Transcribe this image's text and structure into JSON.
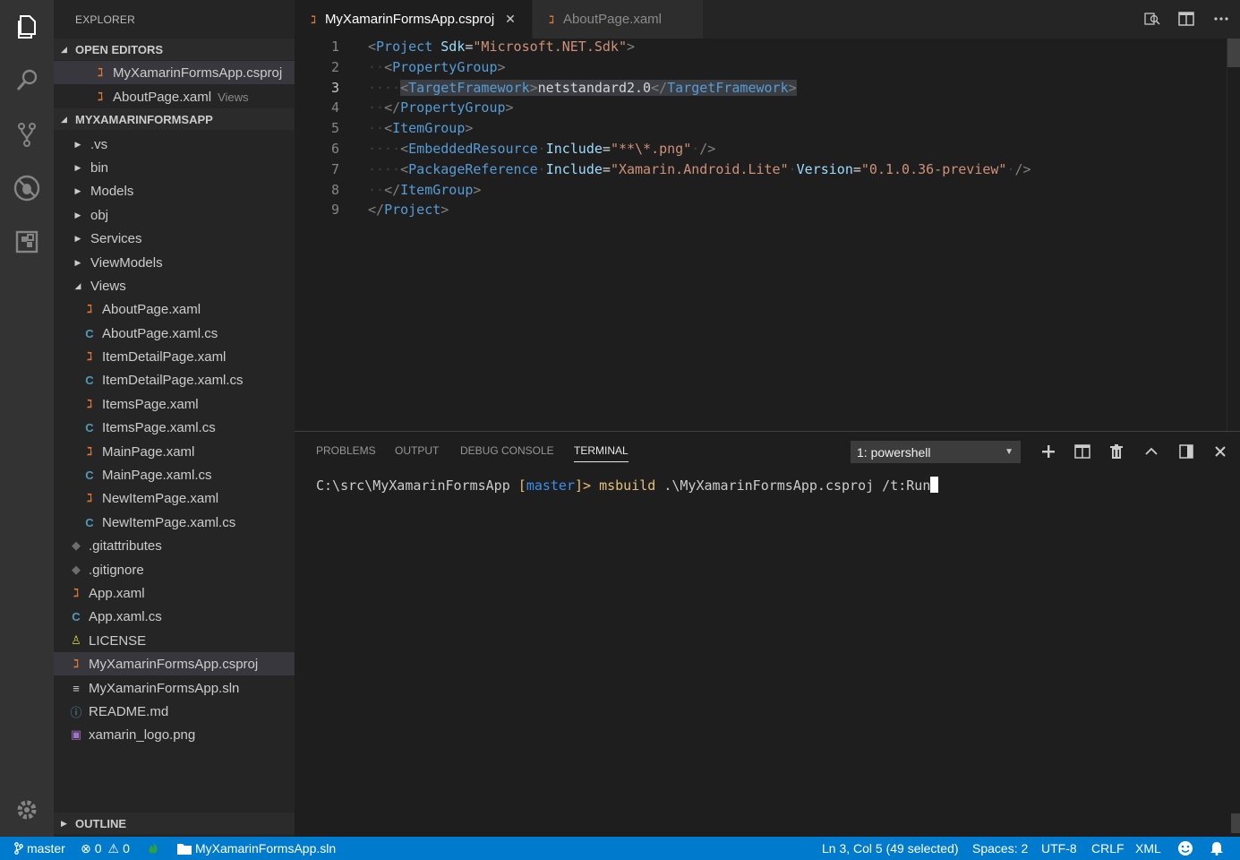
{
  "activity_bar": {
    "items": [
      {
        "icon": "explorer-icon"
      },
      {
        "icon": "search-icon"
      },
      {
        "icon": "source-control-icon"
      },
      {
        "icon": "debug-icon"
      },
      {
        "icon": "extensions-icon"
      }
    ],
    "bottom": {
      "icon": "settings-gear-icon"
    }
  },
  "sidebar": {
    "title": "EXPLORER",
    "open_editors": {
      "label": "OPEN EDITORS",
      "items": [
        {
          "name": "MyXamarinFormsApp.csproj",
          "desc": "",
          "icon": "rss-icon"
        },
        {
          "name": "AboutPage.xaml",
          "desc": "Views",
          "icon": "rss-icon"
        }
      ]
    },
    "project": {
      "label": "MYXAMARINFORMSAPP",
      "items": [
        {
          "name": ".vs",
          "type": "folder"
        },
        {
          "name": "bin",
          "type": "folder"
        },
        {
          "name": "Models",
          "type": "folder"
        },
        {
          "name": "obj",
          "type": "folder"
        },
        {
          "name": "Services",
          "type": "folder"
        },
        {
          "name": "ViewModels",
          "type": "folder"
        },
        {
          "name": "Views",
          "type": "folder-open"
        },
        {
          "name": "AboutPage.xaml",
          "type": "xaml"
        },
        {
          "name": "AboutPage.xaml.cs",
          "type": "cs"
        },
        {
          "name": "ItemDetailPage.xaml",
          "type": "xaml"
        },
        {
          "name": "ItemDetailPage.xaml.cs",
          "type": "cs"
        },
        {
          "name": "ItemsPage.xaml",
          "type": "xaml"
        },
        {
          "name": "ItemsPage.xaml.cs",
          "type": "cs"
        },
        {
          "name": "MainPage.xaml",
          "type": "xaml"
        },
        {
          "name": "MainPage.xaml.cs",
          "type": "cs"
        },
        {
          "name": "NewItemPage.xaml",
          "type": "xaml"
        },
        {
          "name": "NewItemPage.xaml.cs",
          "type": "cs"
        },
        {
          "name": ".gitattributes",
          "type": "git"
        },
        {
          "name": ".gitignore",
          "type": "git"
        },
        {
          "name": "App.xaml",
          "type": "xaml"
        },
        {
          "name": "App.xaml.cs",
          "type": "cs"
        },
        {
          "name": "LICENSE",
          "type": "license"
        },
        {
          "name": "MyXamarinFormsApp.csproj",
          "type": "xaml"
        },
        {
          "name": "MyXamarinFormsApp.sln",
          "type": "sln"
        },
        {
          "name": "README.md",
          "type": "info"
        },
        {
          "name": "xamarin_logo.png",
          "type": "image"
        }
      ]
    },
    "outline": {
      "label": "OUTLINE"
    }
  },
  "tabs": [
    {
      "label": "MyXamarinFormsApp.csproj",
      "active": true,
      "close": "✕"
    },
    {
      "label": "AboutPage.xaml",
      "active": false
    }
  ],
  "editor": {
    "line_numbers": [
      "1",
      "2",
      "3",
      "4",
      "5",
      "6",
      "7",
      "8",
      "9"
    ],
    "current_line": "3",
    "lines": {
      "l1": {
        "lt": "<",
        "tag": "Project",
        "attr1": "Sdk",
        "eq": "=",
        "val1": "\"Microsoft.NET.Sdk\"",
        "gt": ">"
      },
      "l2": {
        "lt": "<",
        "tag": "PropertyGroup",
        "gt": ">"
      },
      "l3": {
        "lt": "<",
        "tag": "TargetFramework",
        "gt": ">",
        "text": "netstandard2.0",
        "lt2": "</",
        "tag2": "TargetFramework",
        "gt2": ">"
      },
      "l4": {
        "lt": "</",
        "tag": "PropertyGroup",
        "gt": ">"
      },
      "l5": {
        "lt": "<",
        "tag": "ItemGroup",
        "gt": ">"
      },
      "l6": {
        "lt": "<",
        "tag": "EmbeddedResource",
        "attr1": "Include",
        "eq": "=",
        "val1": "\"**\\*.png\"",
        "end": "/>"
      },
      "l7": {
        "lt": "<",
        "tag": "PackageReference",
        "attr1": "Include",
        "eq": "=",
        "val1": "\"Xamarin.Android.Lite\"",
        "attr2": "Version",
        "eq2": "=",
        "val2": "\"0.1.0.36-preview\"",
        "end": "/>"
      },
      "l8": {
        "lt": "</",
        "tag": "ItemGroup",
        "gt": ">"
      },
      "l9": {
        "lt": "</",
        "tag": "Project",
        "gt": ">"
      }
    }
  },
  "panel": {
    "tabs": [
      "PROBLEMS",
      "OUTPUT",
      "DEBUG CONSOLE",
      "TERMINAL"
    ],
    "active_tab": "TERMINAL",
    "terminal_select": "1: powershell",
    "terminal": {
      "path": "C:\\src\\MyXamarinFormsApp ",
      "branch_open": "[",
      "branch": "master",
      "branch_close": "]> ",
      "command": "msbuild",
      "args": " .\\MyXamarinFormsApp.csproj /t:Run"
    }
  },
  "status_bar": {
    "branch": "master",
    "errors": "0",
    "warnings": "0",
    "solution": "MyXamarinFormsApp.sln",
    "position": "Ln 3, Col 5 (49 selected)",
    "spaces": "Spaces: 2",
    "encoding": "UTF-8",
    "eol": "CRLF",
    "language": "XML"
  },
  "colors": {
    "activity_bar": "#333333",
    "sidebar": "#252526",
    "editor": "#1e1e1e",
    "status_bar": "#007acc",
    "xml_tag": "#569cd6",
    "xml_attr": "#9cdcfe",
    "xml_string": "#ce9178",
    "file_xaml": "#e37933",
    "file_cs": "#519aba"
  }
}
